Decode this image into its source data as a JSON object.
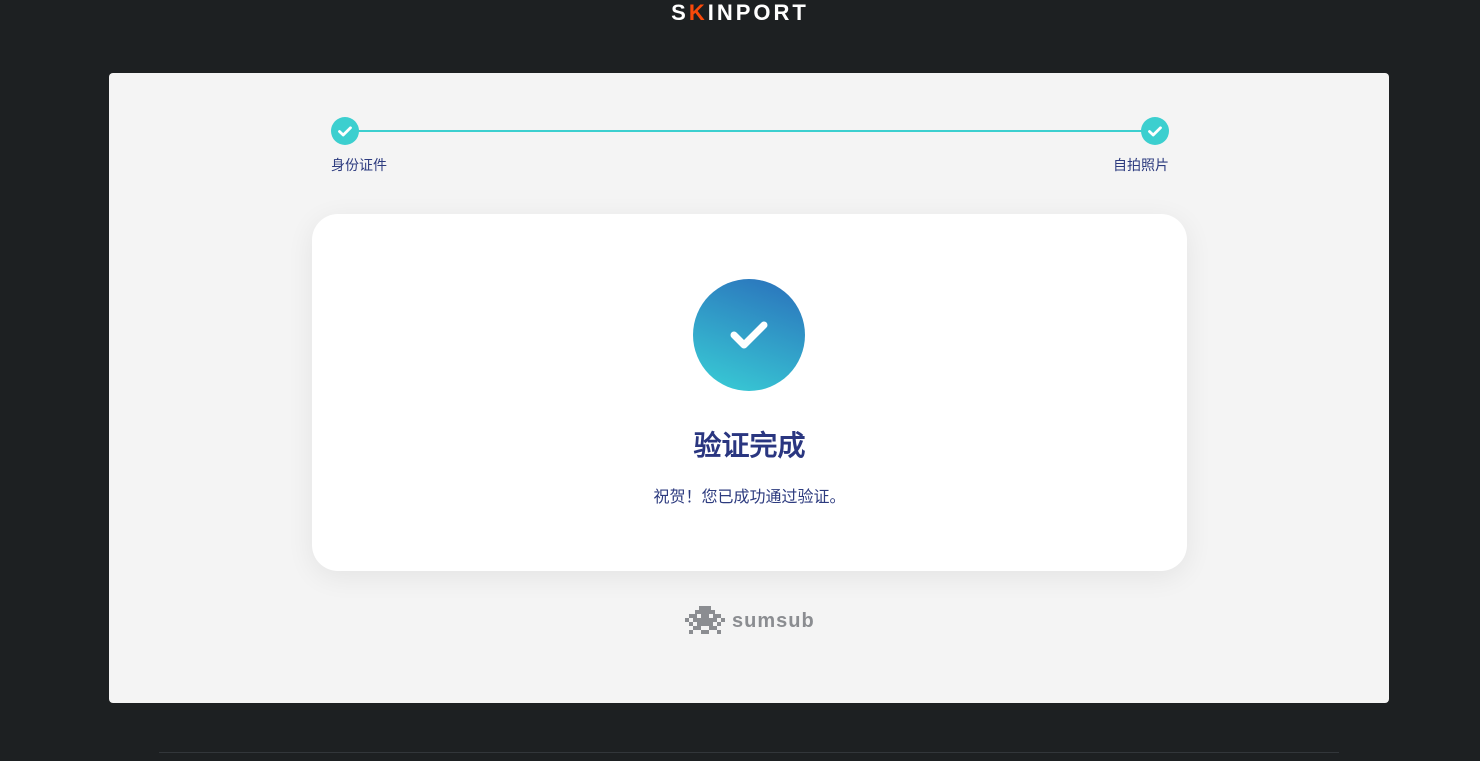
{
  "header": {
    "logo_text_pre": "S",
    "logo_text_accent": "K",
    "logo_text_post": "INPORT",
    "accent_color": "#fa490a"
  },
  "stepper": {
    "steps": [
      {
        "label": "身份证件",
        "icon": "check-icon",
        "completed": true
      },
      {
        "label": "自拍照片",
        "icon": "check-icon",
        "completed": true
      }
    ],
    "accent_color": "#3ccfcf"
  },
  "result": {
    "icon": "check-icon",
    "title": "验证完成",
    "description": "祝贺！您已成功通过验证。"
  },
  "footer": {
    "brand_icon": "sumsub-logo-icon",
    "brand_name": "sumsub"
  }
}
